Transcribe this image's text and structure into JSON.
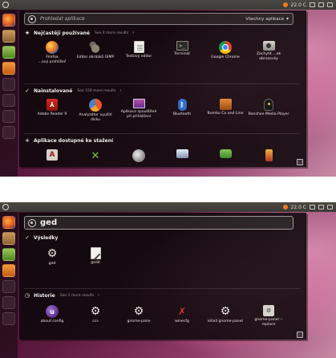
{
  "top": {
    "topbar": {
      "indicator": "22.0 C",
      "clock": ""
    },
    "search": {
      "placeholder": "Prohledat aplikace",
      "value": ""
    },
    "filter": {
      "label": "Všechny aplikace",
      "chevron": "▾"
    },
    "sections": [
      {
        "icon": "star-icon",
        "glyph": "★",
        "title": "Nejčastěji používané",
        "more": "See 4 more results",
        "apps": [
          {
            "label": "Firefox\n...ový prohlížeč",
            "icon": "firefox-icon"
          },
          {
            "label": "Editor obrázků GIMP",
            "icon": "gimp-icon"
          },
          {
            "label": "Textový editor",
            "icon": "text-editor-icon"
          },
          {
            "label": "Terminál",
            "icon": "terminal-icon"
          },
          {
            "label": "Google Chrome",
            "icon": "chrome-icon"
          },
          {
            "label": "Zachytit ...ek obrazovky",
            "icon": "screenshot-icon"
          }
        ]
      },
      {
        "icon": "check-icon",
        "glyph": "✓",
        "title": "Nainstalované",
        "more": "See 150 more results",
        "apps": [
          {
            "label": "Adobe Reader 9",
            "icon": "adobe-reader-icon"
          },
          {
            "label": "Analyzátor využití disku",
            "icon": "disk-usage-icon"
          },
          {
            "label": "Aplikace spouštěné při přihlášení",
            "icon": "startup-apps-icon"
          },
          {
            "label": "Bluetooth",
            "icon": "bluetooth-icon"
          },
          {
            "label": "Bombu Co and Line",
            "icon": "ubuntu-one-icon"
          },
          {
            "label": "Banshee Media Player",
            "icon": "banshee-icon"
          }
        ]
      },
      {
        "icon": "plus-icon",
        "glyph": "+",
        "title": "Aplikace dostupné ke stažení",
        "more": "",
        "apps": [
          {
            "label": "",
            "icon": "font-app-icon"
          },
          {
            "label": "",
            "icon": "xcircle-icon"
          },
          {
            "label": "",
            "icon": "gray-app-icon"
          },
          {
            "label": "",
            "icon": "drive-app-icon"
          },
          {
            "label": "",
            "icon": "chat-app-icon"
          },
          {
            "label": "",
            "icon": "joystick-icon"
          }
        ]
      }
    ]
  },
  "bottom": {
    "topbar": {
      "indicator": "22.0 C",
      "clock": ""
    },
    "search": {
      "placeholder": "",
      "value": "ged"
    },
    "sections": [
      {
        "icon": "check-icon",
        "glyph": "✓",
        "title": "Výsledky",
        "more": "",
        "apps": [
          {
            "label": "ged",
            "icon": "gear-icon"
          },
          {
            "label": "gedit",
            "icon": "gedit-icon"
          }
        ]
      },
      {
        "icon": "clock-icon",
        "glyph": "◷",
        "title": "Historie",
        "more": "See 2 more results",
        "apps": [
          {
            "label": "about:config",
            "icon": "about-config-icon"
          },
          {
            "label": "ccs",
            "icon": "gear-icon"
          },
          {
            "label": "gnome-pane",
            "icon": "gear-icon"
          },
          {
            "label": "winecfg",
            "icon": "wine-icon"
          },
          {
            "label": "killall gnome-panel",
            "icon": "gear-icon"
          },
          {
            "label": "gnome-panel --replace",
            "icon": "replace-icon"
          }
        ]
      }
    ]
  }
}
